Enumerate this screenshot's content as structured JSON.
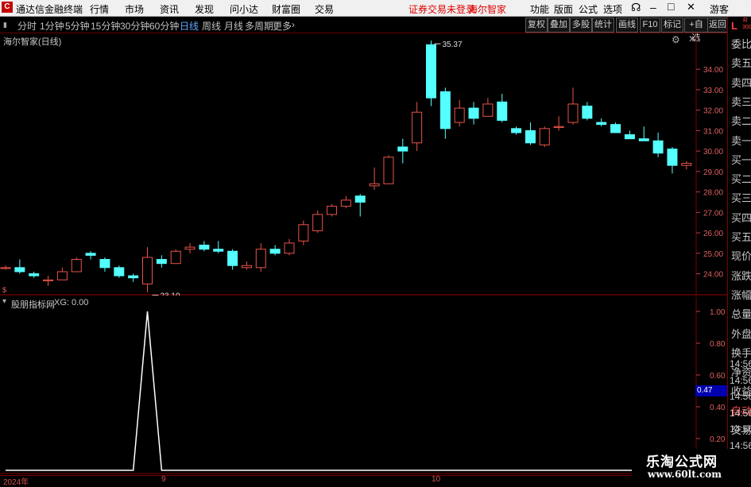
{
  "menu": {
    "logo": "C",
    "app_title": "通达信金融终端",
    "items": [
      "行情",
      "市场",
      "资讯",
      "发现",
      "问小达",
      "财富圈",
      "交易"
    ],
    "warning": "证券交易未登录",
    "stock": "海尔智家",
    "right_items": [
      "功能",
      "版面",
      "公式",
      "选项"
    ],
    "user": "游客"
  },
  "periods": {
    "items": [
      "分时",
      "1分钟",
      "5分钟",
      "15分钟",
      "30分钟",
      "60分钟",
      "日线",
      "周线",
      "月线",
      "多周期",
      "更多"
    ],
    "active": "日线",
    "buttons": [
      "复权",
      "叠加",
      "多股",
      "统计",
      "画线",
      "F10",
      "标记",
      "+自选",
      "返回"
    ]
  },
  "main_title": "海尔智家(日线)",
  "indicator_title": "股朋指标网",
  "indicator_value": "XG: 0.00",
  "right_panel": {
    "top": "L",
    "sub": "300",
    "r": "R",
    "labels": [
      "委比",
      "卖五",
      "卖四",
      "卖三",
      "卖二",
      "卖一",
      "买一",
      "买二",
      "买三",
      "买四",
      "买五",
      "现价",
      "涨跌",
      "涨幅",
      "总量",
      "外盘",
      "换手",
      "净资",
      "收益",
      "自动",
      "交易"
    ],
    "times": [
      "14:56",
      "14:56",
      "14:56",
      "14:56",
      "14:56",
      "14:56",
      "14:56",
      "14:56"
    ]
  },
  "colors": {
    "up": "#e8534a",
    "down": "#54ffff",
    "grid": "#7a0000",
    "line": "#ffffff"
  },
  "chart_data": [
    {
      "type": "candlestick",
      "title": "海尔智家(日线)",
      "y_ticks": [
        "34.00",
        "33.00",
        "32.00",
        "31.00",
        "30.00",
        "29.00",
        "28.00",
        "27.00",
        "26.00",
        "25.00",
        "24.00"
      ],
      "ylim": [
        23.4,
        35.6
      ],
      "max_label": "35.37",
      "min_label": "23.10",
      "x_labels": [
        "2024年",
        "9",
        "10"
      ],
      "candles": [
        {
          "o": 24.3,
          "h": 24.4,
          "l": 24.2,
          "c": 24.3
        },
        {
          "o": 24.3,
          "h": 24.7,
          "l": 24.0,
          "c": 24.1
        },
        {
          "o": 24.0,
          "h": 24.1,
          "l": 23.8,
          "c": 23.9
        },
        {
          "o": 23.7,
          "h": 23.9,
          "l": 23.4,
          "c": 23.7
        },
        {
          "o": 23.7,
          "h": 24.3,
          "l": 23.7,
          "c": 24.1
        },
        {
          "o": 24.1,
          "h": 24.8,
          "l": 24.1,
          "c": 24.7
        },
        {
          "o": 25.0,
          "h": 25.1,
          "l": 24.7,
          "c": 24.9
        },
        {
          "o": 24.7,
          "h": 24.8,
          "l": 24.1,
          "c": 24.3
        },
        {
          "o": 24.3,
          "h": 24.4,
          "l": 23.8,
          "c": 23.9
        },
        {
          "o": 23.9,
          "h": 24.0,
          "l": 23.6,
          "c": 23.8
        },
        {
          "o": 23.5,
          "h": 25.3,
          "l": 23.1,
          "c": 24.8
        },
        {
          "o": 24.7,
          "h": 24.9,
          "l": 24.3,
          "c": 24.5
        },
        {
          "o": 24.5,
          "h": 25.2,
          "l": 24.5,
          "c": 25.1
        },
        {
          "o": 25.2,
          "h": 25.5,
          "l": 25.0,
          "c": 25.3
        },
        {
          "o": 25.4,
          "h": 25.6,
          "l": 25.1,
          "c": 25.2
        },
        {
          "o": 25.2,
          "h": 25.6,
          "l": 25.0,
          "c": 25.1
        },
        {
          "o": 25.1,
          "h": 25.2,
          "l": 24.2,
          "c": 24.4
        },
        {
          "o": 24.3,
          "h": 24.6,
          "l": 24.2,
          "c": 24.4
        },
        {
          "o": 24.3,
          "h": 25.5,
          "l": 24.1,
          "c": 25.2
        },
        {
          "o": 25.2,
          "h": 25.4,
          "l": 24.9,
          "c": 25.0
        },
        {
          "o": 25.0,
          "h": 25.7,
          "l": 24.9,
          "c": 25.5
        },
        {
          "o": 25.6,
          "h": 26.6,
          "l": 25.4,
          "c": 26.4
        },
        {
          "o": 26.1,
          "h": 27.1,
          "l": 26.0,
          "c": 26.9
        },
        {
          "o": 26.9,
          "h": 27.4,
          "l": 26.8,
          "c": 27.3
        },
        {
          "o": 27.3,
          "h": 27.8,
          "l": 27.2,
          "c": 27.6
        },
        {
          "o": 27.8,
          "h": 27.9,
          "l": 26.8,
          "c": 27.5
        },
        {
          "o": 28.3,
          "h": 29.2,
          "l": 28.1,
          "c": 28.4
        },
        {
          "o": 28.4,
          "h": 29.8,
          "l": 28.4,
          "c": 29.7
        },
        {
          "o": 30.2,
          "h": 30.6,
          "l": 29.4,
          "c": 30.0
        },
        {
          "o": 30.4,
          "h": 32.4,
          "l": 30.0,
          "c": 31.9
        },
        {
          "o": 35.2,
          "h": 35.4,
          "l": 32.2,
          "c": 32.6
        },
        {
          "o": 32.9,
          "h": 33.1,
          "l": 30.6,
          "c": 31.1
        },
        {
          "o": 31.4,
          "h": 32.5,
          "l": 31.2,
          "c": 32.1
        },
        {
          "o": 32.1,
          "h": 32.4,
          "l": 31.3,
          "c": 31.6
        },
        {
          "o": 31.7,
          "h": 32.6,
          "l": 31.7,
          "c": 32.3
        },
        {
          "o": 32.4,
          "h": 32.8,
          "l": 31.4,
          "c": 31.5
        },
        {
          "o": 31.1,
          "h": 31.2,
          "l": 30.8,
          "c": 30.9
        },
        {
          "o": 31.0,
          "h": 31.4,
          "l": 30.3,
          "c": 30.4
        },
        {
          "o": 30.3,
          "h": 31.2,
          "l": 30.2,
          "c": 31.1
        },
        {
          "o": 31.2,
          "h": 31.7,
          "l": 31.0,
          "c": 31.2
        },
        {
          "o": 31.4,
          "h": 33.1,
          "l": 31.3,
          "c": 32.3
        },
        {
          "o": 32.2,
          "h": 32.4,
          "l": 31.5,
          "c": 31.6
        },
        {
          "o": 31.4,
          "h": 31.6,
          "l": 31.2,
          "c": 31.3
        },
        {
          "o": 31.3,
          "h": 31.4,
          "l": 30.9,
          "c": 30.9
        },
        {
          "o": 30.8,
          "h": 31.0,
          "l": 30.6,
          "c": 30.6
        },
        {
          "o": 30.6,
          "h": 31.2,
          "l": 30.5,
          "c": 30.5
        },
        {
          "o": 30.5,
          "h": 30.9,
          "l": 29.7,
          "c": 29.9
        },
        {
          "o": 30.1,
          "h": 30.2,
          "l": 28.9,
          "c": 29.3
        },
        {
          "o": 29.3,
          "h": 29.5,
          "l": 29.1,
          "c": 29.4
        }
      ]
    },
    {
      "type": "line",
      "title": "股朋指标网",
      "series": [
        {
          "name": "XG",
          "values": [
            0,
            0,
            0,
            0,
            0,
            0,
            0,
            0,
            0,
            0,
            1,
            0,
            0,
            0,
            0,
            0,
            0,
            0,
            0,
            0,
            0,
            0,
            0,
            0,
            0,
            0,
            0,
            0,
            0,
            0,
            0,
            0,
            0,
            0,
            0,
            0,
            0,
            0,
            0,
            0,
            0,
            0,
            0,
            0,
            0,
            0,
            0,
            0,
            0
          ]
        }
      ],
      "y_ticks": [
        "1.00",
        "0.80",
        "0.60",
        "0.40",
        "0.20"
      ],
      "ylim": [
        0,
        1
      ],
      "current": "0.47"
    }
  ],
  "watermark": {
    "line1": "乐淘公式网",
    "line2": "www.60lt.com"
  }
}
